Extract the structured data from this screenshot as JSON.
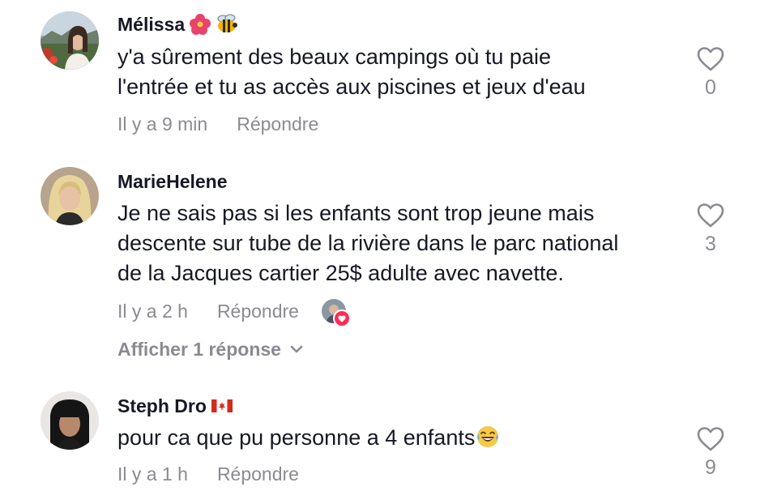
{
  "comments": [
    {
      "username": "Mélissa",
      "lines": [
        "y'a sûrement des beaux campings où tu paie",
        "l'entrée et tu as accès aux piscines et jeux d'eau"
      ],
      "time": "Il y a 9 min",
      "reply_label": "Répondre",
      "like_count": "0"
    },
    {
      "username": "MarieHelene",
      "lines": [
        "Je ne sais pas si les enfants sont trop jeune mais",
        "descente sur tube de la rivière dans le parc national",
        "de la Jacques cartier 25$ adulte avec navette."
      ],
      "time": "Il y a 2 h",
      "reply_label": "Répondre",
      "like_count": "3",
      "view_replies_label": "Afficher 1 réponse"
    },
    {
      "username": "Steph Dro",
      "lines": [
        "pour ca que pu personne a 4 enfants"
      ],
      "time": "Il y a 1 h",
      "reply_label": "Répondre",
      "like_count": "9"
    }
  ],
  "colors": {
    "text": "#161823",
    "secondary": "#8a8b91",
    "heart_badge": "#fe2c55"
  },
  "icons": {
    "like": "heart-outline-icon",
    "expand": "chevron-down-icon",
    "flag": "canada-flag-icon"
  }
}
